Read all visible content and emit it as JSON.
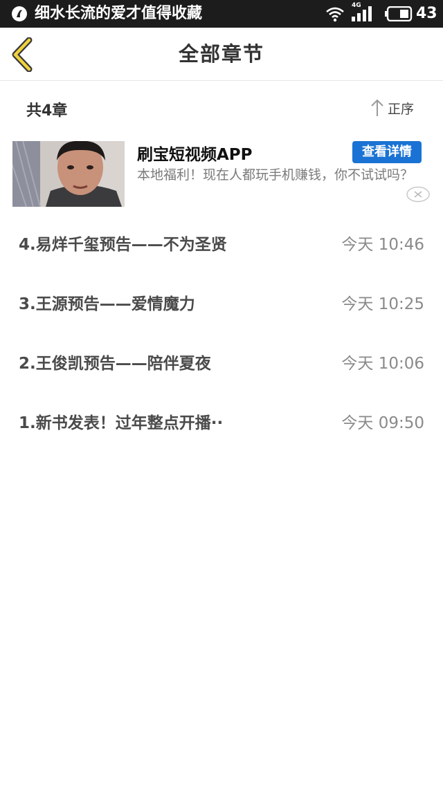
{
  "status_bar": {
    "notification_text": "细水长流的爱才值得收藏",
    "network_type": "4G",
    "battery_level": "43"
  },
  "header": {
    "title": "全部章节"
  },
  "summary": {
    "chapter_count": "共4章",
    "sort_label": "正序"
  },
  "ad": {
    "title": "刷宝短视频APP",
    "button_label": "查看详情",
    "description": "本地福利！现在人都玩手机赚钱，你不试试吗？"
  },
  "chapters": [
    {
      "title": "4.易烊千玺预告——不为圣贤",
      "time": "今天 10:46"
    },
    {
      "title": "3.王源预告——爱情魔力",
      "time": "今天 10:25"
    },
    {
      "title": "2.王俊凯预告——陪伴夏夜",
      "time": "今天 10:06"
    },
    {
      "title": "1.新书发表！过年整点开播··",
      "time": "今天 09:50"
    }
  ],
  "colors": {
    "accent_yellow": "#f0d23c",
    "ad_button_blue": "#1a73d4",
    "status_bar_bg": "#1c1c1c"
  }
}
